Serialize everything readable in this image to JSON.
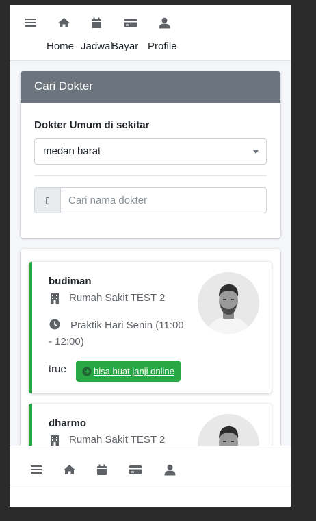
{
  "top_nav": {
    "home_label": "Home",
    "jadwal_label": "Jadwal",
    "bayar_label": "Bayar",
    "profile_label": "Profile"
  },
  "search_card": {
    "header": "Cari Dokter",
    "section_label": "Dokter Umum di sekitar",
    "location_select_value": "medan barat",
    "search_placeholder": "Cari nama dokter",
    "search_icon_glyph": "▯"
  },
  "doctors": [
    {
      "name": "budiman",
      "hospital": "Rumah Sakit TEST 2",
      "schedule_line1": "Praktik Hari Senin (11:00",
      "schedule_line2": "- 12:00)",
      "status": "true",
      "action_label": "bisa buat janji online"
    },
    {
      "name": "dharmo",
      "hospital": "Rumah Sakit TEST 2"
    }
  ],
  "icons": {
    "menu": "menu-icon",
    "home": "home-icon",
    "calendar": "calendar-icon",
    "card": "credit-card-icon",
    "user": "user-icon",
    "hospital": "hospital-icon",
    "clock": "clock-icon",
    "arrow": "arrow-circle-right-icon"
  },
  "colors": {
    "header_bg": "#6c757d",
    "accent_green": "#28a745",
    "icon_gray": "#5f6368"
  }
}
